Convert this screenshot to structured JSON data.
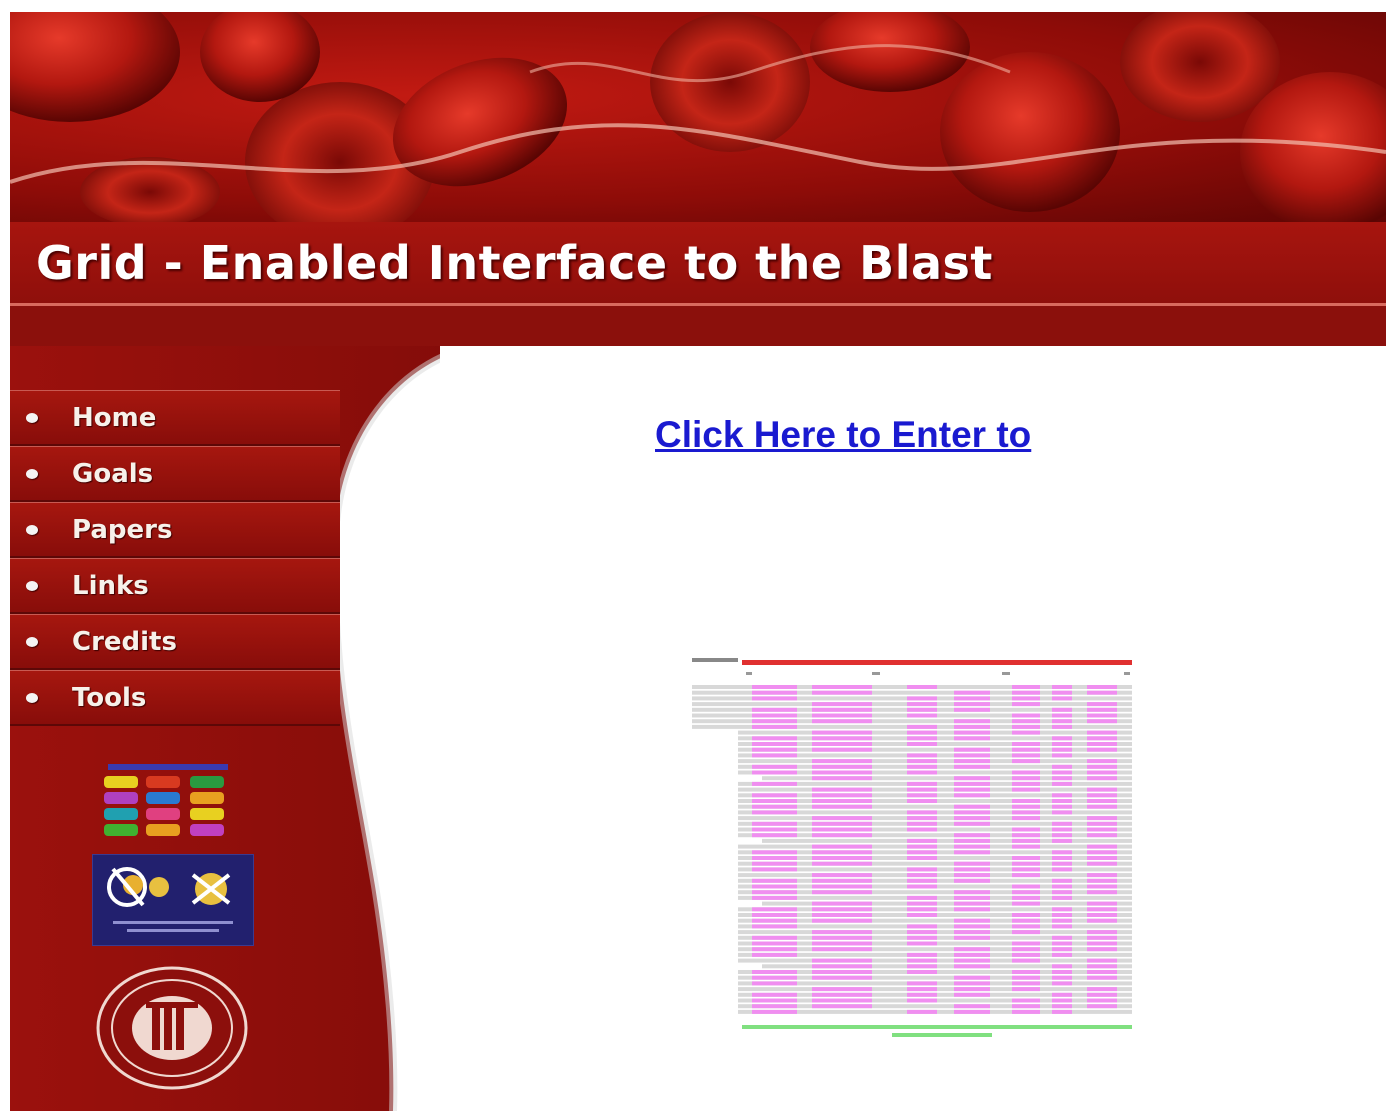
{
  "header": {
    "title": "Grid - Enabled Interface to the Blast"
  },
  "sidebar": {
    "items": [
      {
        "label": "Home"
      },
      {
        "label": "Goals"
      },
      {
        "label": "Papers"
      },
      {
        "label": "Links"
      },
      {
        "label": "Credits"
      },
      {
        "label": "Tools"
      }
    ],
    "logos": [
      "color-blocks-logo",
      "partner-logo",
      "university-seal-logo"
    ]
  },
  "main": {
    "enter_link": "Click Here to Enter to",
    "figure": "sequence-alignment-image"
  },
  "colors": {
    "banner_red": "#a7150f",
    "link_blue": "#1a1ad0",
    "alignment_pink": "#f08ef0"
  }
}
